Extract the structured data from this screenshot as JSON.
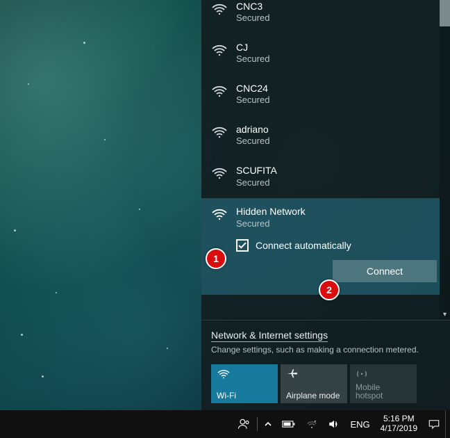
{
  "networks": [
    {
      "name": "CNC3",
      "status": "Secured",
      "partial": true
    },
    {
      "name": "CJ",
      "status": "Secured"
    },
    {
      "name": "CNC24",
      "status": "Secured"
    },
    {
      "name": "adriano",
      "status": "Secured"
    },
    {
      "name": "SCUFITA",
      "status": "Secured"
    }
  ],
  "selected_network": {
    "name": "Hidden Network",
    "status": "Secured",
    "checkbox_label": "Connect automatically",
    "checked": true,
    "connect_label": "Connect"
  },
  "callouts": {
    "one": "1",
    "two": "2"
  },
  "settings": {
    "link": "Network & Internet settings",
    "desc": "Change settings, such as making a connection metered."
  },
  "quick": {
    "wifi": "Wi-Fi",
    "airplane": "Airplane mode",
    "hotspot1": "Mobile",
    "hotspot2": "hotspot"
  },
  "tray": {
    "lang": "ENG",
    "time": "5:16 PM",
    "date": "4/17/2019"
  }
}
